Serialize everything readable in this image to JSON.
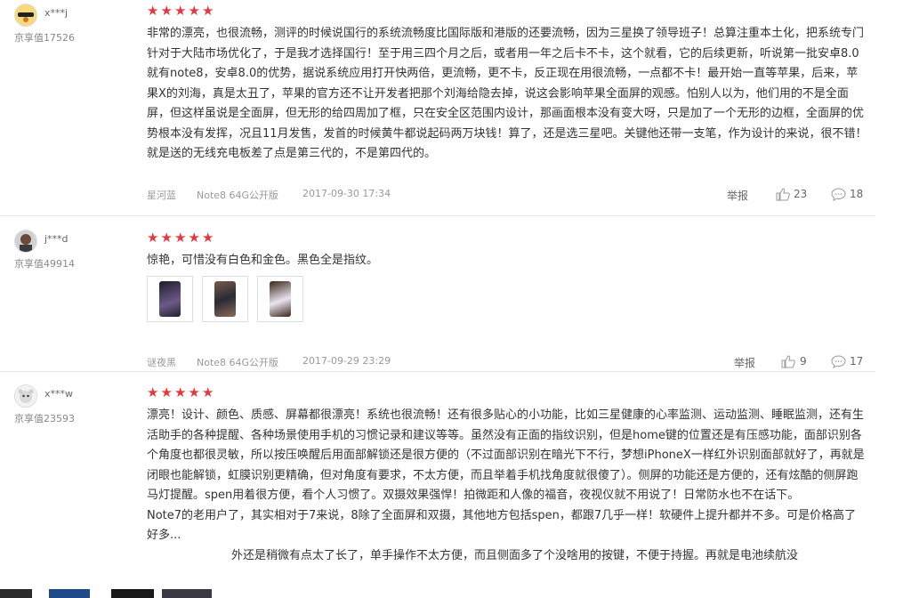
{
  "reviews": [
    {
      "user": "x***j",
      "score_label": "京享值17526",
      "stars": 5,
      "paragraphs": [
        "非常的漂亮，也很流畅，测评的时候说国行的系统流畅度比国际版和港版的还要流畅，因为三星换了领导班子！总算注重本土化，把系统专门针对于大陆市场优化了，于是我才选择国行！至于用三四个月之后，或者用一年之后卡不卡，这个就看，它的后续更新，听说第一批安卓8.0就有note8，安卓8.0的优势，据说系统应用打开快两倍，更流畅，更不卡，反正现在用很流畅，一点都不卡！最开始一直等苹果，后来，苹果X的刘海，真是太丑了，苹果的官方还不让开发者把那个刘海给隐去掉，说这会影响苹果全面屏的观感。怕别人以为，他们用的不是全面屏，但这样虽说是全面屏，但无形的给四周加了框，只在安全区范围内设计，那画面根本没有变大呀，只是加了一个无形的边框，全面屏的优势根本没有发挥，况且11月发售，发首的时候黄牛都说起码两万块钱！算了，还是选三星吧。关键他还带一支笔，作为设计的来说，很不错！就是送的无线充电板差了点是第三代的，不是第四代的。"
      ],
      "color": "星河蓝",
      "spec": "Note8 64G公开版",
      "time": "2017-09-30 17:34",
      "report": "举报",
      "likes": "23",
      "comments": "18"
    },
    {
      "user": "j***d",
      "score_label": "京享值49914",
      "stars": 5,
      "paragraphs": [
        "惊艳，可惜没有白色和金色。黑色全是指纹。"
      ],
      "color": "谜夜黑",
      "spec": "Note8 64G公开版",
      "time": "2017-09-29 23:29",
      "report": "举报",
      "likes": "9",
      "comments": "17"
    },
    {
      "user": "x***w",
      "score_label": "京享值23593",
      "stars": 5,
      "paragraphs": [
        "漂亮！设计、颜色、质感、屏幕都很漂亮！系统也很流畅！还有很多贴心的小功能，比如三星健康的心率监测、运动监测、睡眠监测，还有生活助手的各种提醒、各种场景使用手机的习惯记录和建议等等。虽然没有正面的指纹识别，但是home键的位置还是有压感功能，面部识别各个角度也都很灵敏，所以按压唤醒后用面部解锁还是很方便的（不过面部识别在暗光下不行，梦想iPhoneX一样红外识别面部就好了，再就是闭眼也能解锁，虹膜识别更精确，但对角度有要求，不太方便，而且举着手机找角度就很傻了）。侧屏的功能还是方便的，还有炫酷的侧屏跑马灯提醒。spen用着很方便，看个人习惯了。双摄效果强悍！拍微距和人像的福音，夜视仪就不用说了！日常防水也不在话下。",
        "Note7的老用户了，其实相对于7来说，8除了全面屏和双摄，其他地方包括spen，都跟7几乎一样！软硬件上提升都并不多。可是价格高了好多...",
        "外还是稍微有点太了长了，单手操作不太方便，而且侧面多了个没啥用的按键，不便于持握。再就是电池续航没"
      ]
    }
  ],
  "colors": {
    "star": "#e4393c",
    "border": "#e9e9e9",
    "meta": "#999999"
  },
  "icons": [
    "avatar-image",
    "star-icon",
    "thumbs-up-icon",
    "comment-bubble-icon"
  ]
}
